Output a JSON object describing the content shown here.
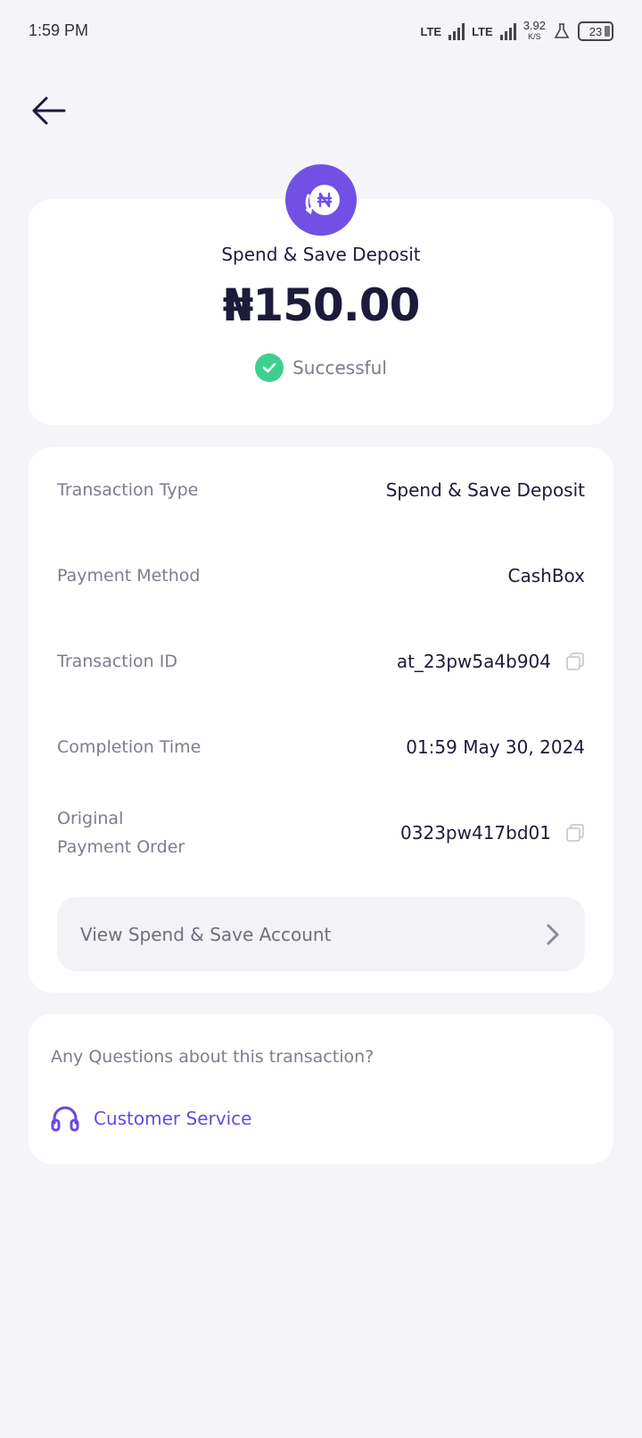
{
  "status_bar": {
    "time": "1:59 PM",
    "network_1": "LTE",
    "network_2": "LTE",
    "speed_value": "3.92",
    "speed_unit": "K/S",
    "battery": "23"
  },
  "header": {
    "back_icon": "arrow-left-icon"
  },
  "summary": {
    "icon": "naira-coin-icon",
    "title": "Spend & Save Deposit",
    "amount": "₦150.00",
    "status": "Successful",
    "status_color": "#3ecf8e",
    "accent_color": "#7250e6"
  },
  "details": {
    "rows": [
      {
        "label": "Transaction Type",
        "value": "Spend & Save Deposit"
      },
      {
        "label": "Payment Method",
        "value": "CashBox"
      },
      {
        "label": "Transaction ID",
        "value": "at_23pw5a4b904"
      },
      {
        "label": "Completion Time",
        "value": "01:59 May 30, 2024"
      },
      {
        "label": "Original Payment Order",
        "value": "0323pw417bd01"
      }
    ],
    "view_account_label": "View Spend & Save Account"
  },
  "help": {
    "question": "Any Questions about this transaction?",
    "customer_service_label": "Customer Service"
  }
}
